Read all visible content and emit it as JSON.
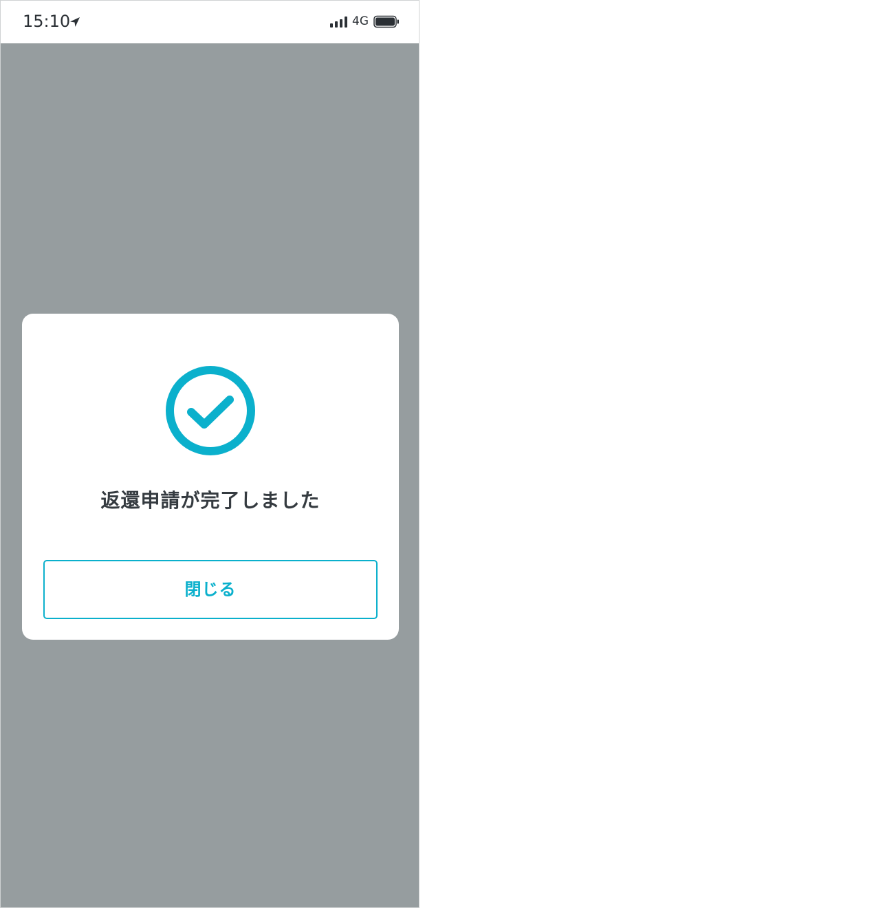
{
  "status_bar": {
    "time": "15:10",
    "network": "4G",
    "icons": [
      "location-arrow-icon",
      "signal-bars-icon",
      "battery-icon"
    ]
  },
  "modal": {
    "icon": "check-circle-icon",
    "message": "返還申請が完了しました",
    "close_label": "閉じる"
  },
  "colors": {
    "accent": "#0bb0cc",
    "overlay": "#969d9f",
    "text": "#353b40"
  }
}
